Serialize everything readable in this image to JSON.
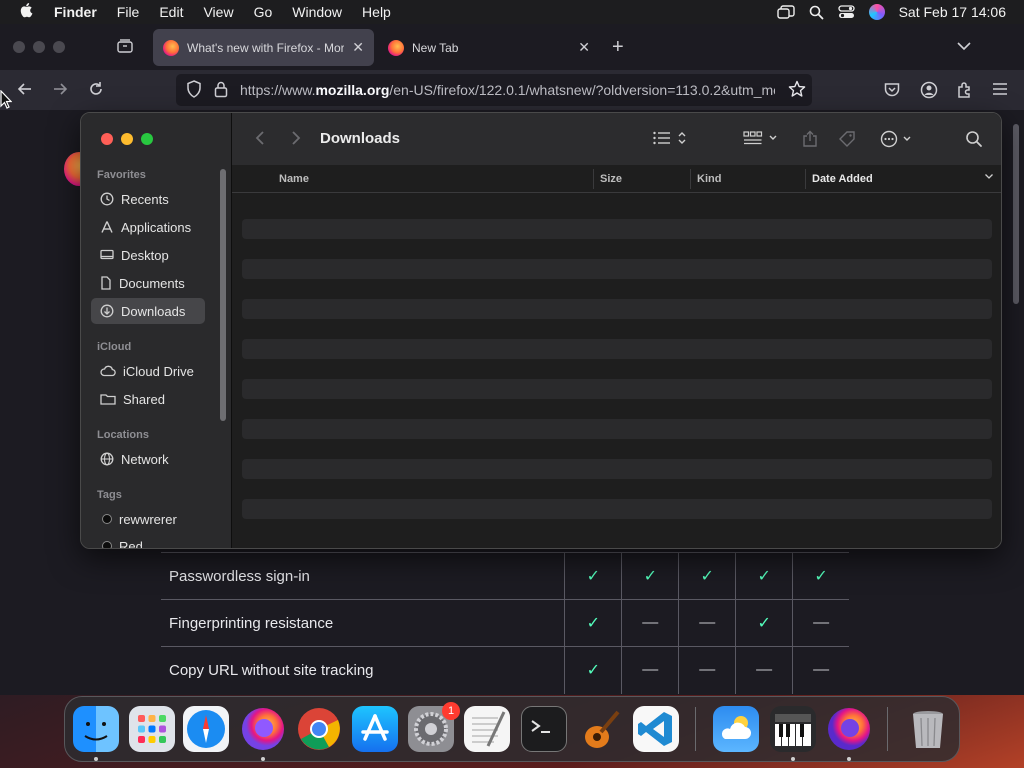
{
  "menubar": {
    "app": "Finder",
    "items": [
      "File",
      "Edit",
      "View",
      "Go",
      "Window",
      "Help"
    ],
    "clock": "Sat Feb 17  14:06"
  },
  "browser": {
    "tabs": [
      {
        "label": "What's new with Firefox - More",
        "active": true
      },
      {
        "label": "New Tab",
        "active": false
      }
    ],
    "url_prefix": "https://www.",
    "url_domain": "mozilla.org",
    "url_rest": "/en-US/firefox/122.0.1/whatsnew/?oldversion=113.0.2&utm_me"
  },
  "features_table": {
    "rows": [
      {
        "name": "Passwordless sign-in",
        "cells": [
          "check",
          "check",
          "check",
          "check",
          "check"
        ]
      },
      {
        "name": "Fingerprinting resistance",
        "cells": [
          "check",
          "dash",
          "dash",
          "check",
          "dash"
        ]
      },
      {
        "name": "Copy URL without site tracking",
        "cells": [
          "check",
          "dash",
          "dash",
          "dash",
          "dash"
        ]
      }
    ]
  },
  "finder": {
    "title": "Downloads",
    "sections": {
      "favorites": "Favorites",
      "icloud": "iCloud",
      "locations": "Locations",
      "tags": "Tags"
    },
    "favorites": [
      "Recents",
      "Applications",
      "Desktop",
      "Documents",
      "Downloads"
    ],
    "icloud": [
      "iCloud Drive",
      "Shared"
    ],
    "locations": [
      "Network"
    ],
    "tags": [
      "rewwrerer",
      "Red"
    ],
    "columns": {
      "name": "Name",
      "size": "Size",
      "kind": "Kind",
      "date": "Date Added"
    },
    "selected": "Downloads"
  },
  "dock": {
    "apps": [
      "Finder",
      "Launchpad",
      "Safari",
      "Firefox",
      "Chrome",
      "App Store",
      "System Settings",
      "TextEdit",
      "Terminal",
      "GarageBand",
      "Visual Studio Code",
      "Weather",
      "Piano",
      "Firefox Nightly",
      "Trash"
    ],
    "badge": "1"
  },
  "colors": {
    "check": "#54ffbd",
    "finder_selection": "#464649",
    "traffic_red": "#ff5f57",
    "traffic_yellow": "#febc2e",
    "traffic_green": "#28c840"
  }
}
